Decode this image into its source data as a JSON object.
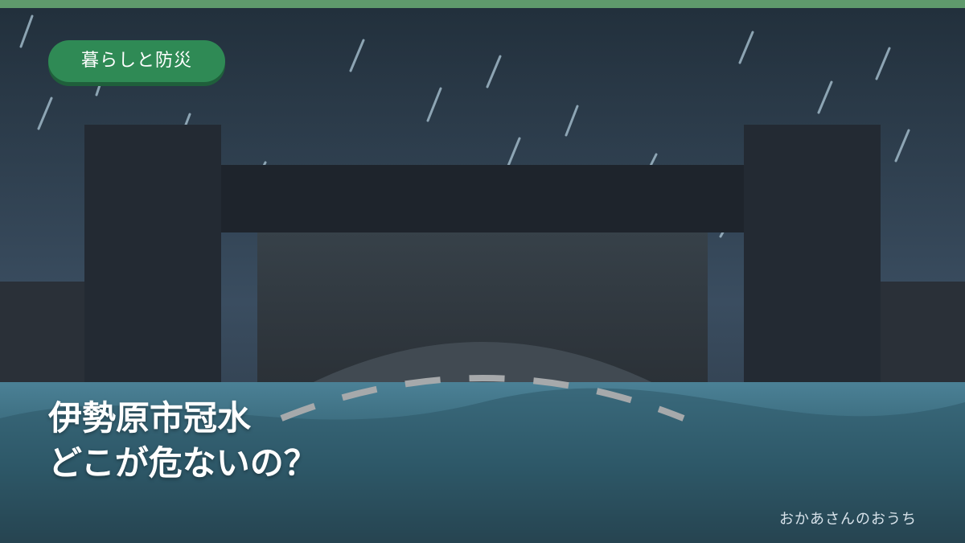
{
  "badge": {
    "label": "暮らしと防災"
  },
  "title": {
    "line1": "伊勢原市冠水",
    "line2": "どこが危ないの？"
  },
  "credit": {
    "text": "おかあさんのおうち"
  },
  "colors": {
    "top_bar": "#5f9a6c",
    "sky_top": "#22303c",
    "sky_bottom": "#3f5467",
    "bridge": "#232a33",
    "water": "#3f7286",
    "badge": "#2f8a55"
  },
  "icons": {
    "rain": "rain-streak",
    "bridge": "bridge-shape",
    "water": "flood-water"
  }
}
